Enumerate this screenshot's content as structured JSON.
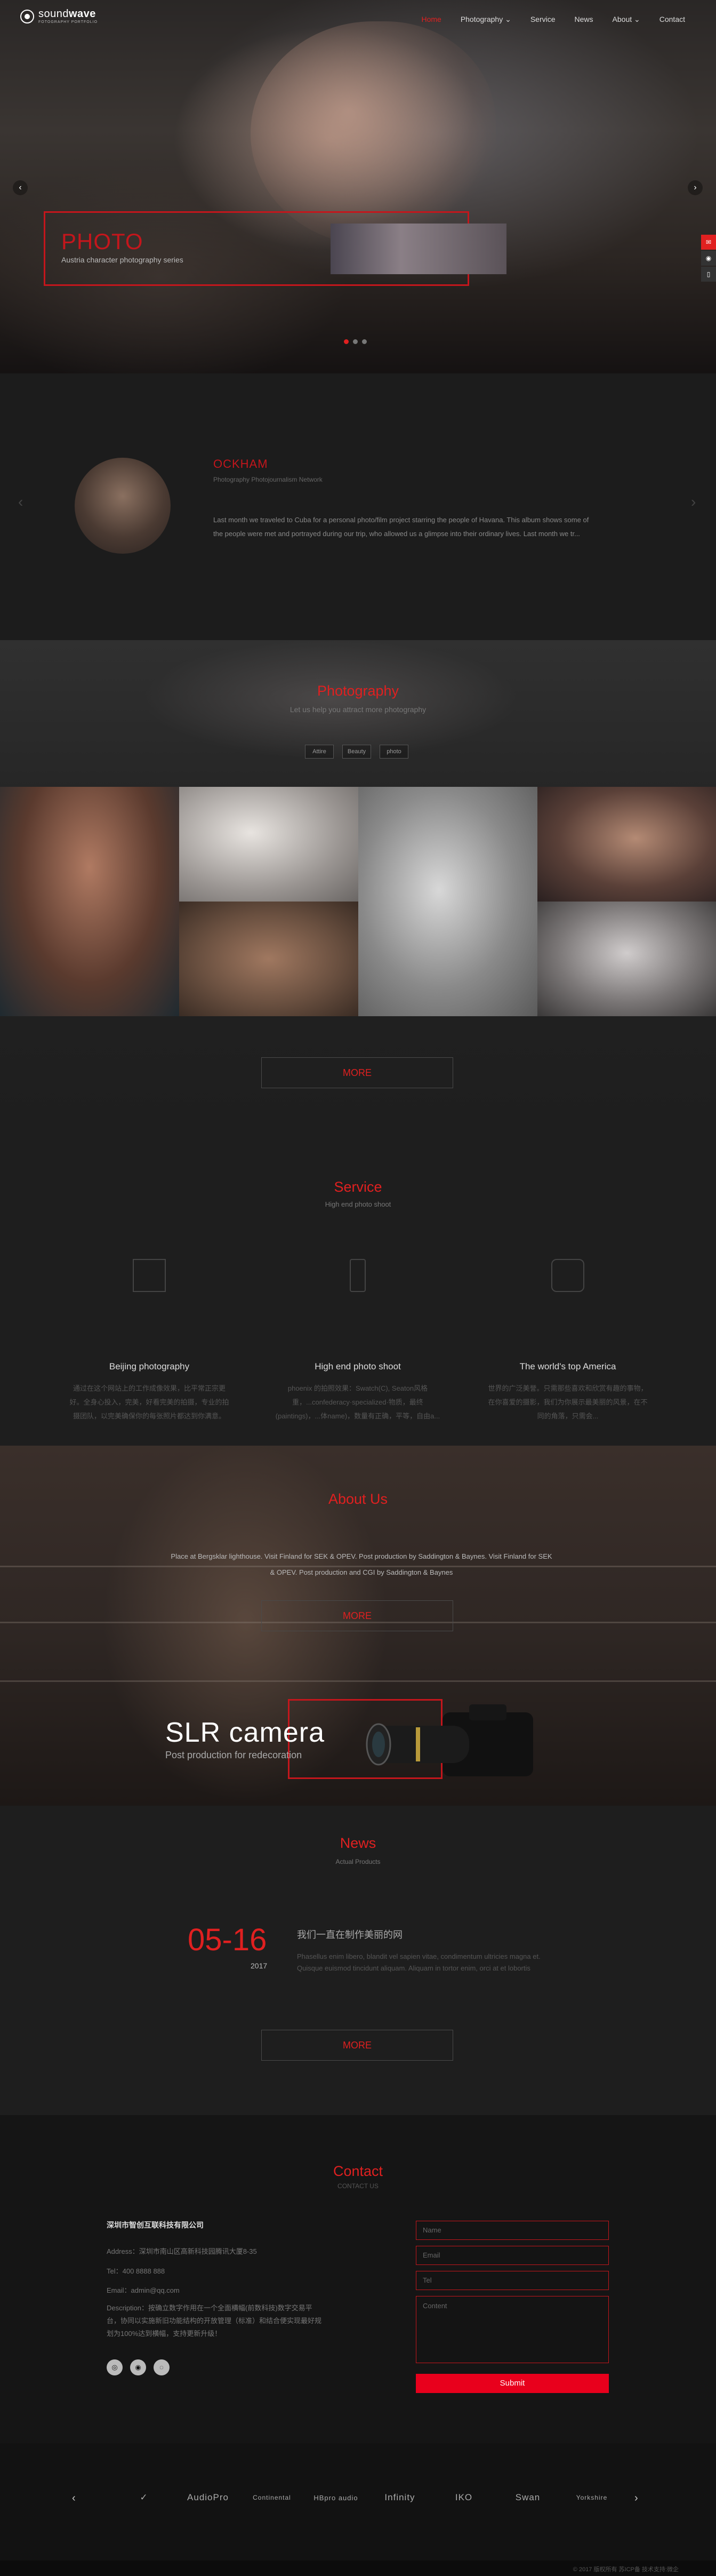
{
  "brand": {
    "name_light": "sound",
    "name_bold": "wave",
    "sub": "FOTOGRAPHY PORTFOLIO"
  },
  "nav": [
    {
      "label": "Home",
      "active": true
    },
    {
      "label": "Photography ⌄",
      "active": false
    },
    {
      "label": "Service",
      "active": false
    },
    {
      "label": "News",
      "active": false
    },
    {
      "label": "About ⌄",
      "active": false
    },
    {
      "label": "Contact",
      "active": false
    }
  ],
  "hero": {
    "title": "PHOTO",
    "subtitle": "Austria character photography series",
    "prev": "‹",
    "next": "›"
  },
  "side_tools": [
    "chat-icon",
    "qq-icon",
    "phone-icon"
  ],
  "profile": {
    "name": "OCKHAM",
    "role": "Photography Photojournalism Network",
    "text": "Last month we traveled to Cuba for a personal photo/film project starring the people of Havana. This album shows some of the people were met and portrayed during our trip, who allowed us a glimpse into their ordinary lives. Last month we tr..."
  },
  "photography": {
    "title": "Photography",
    "subtitle": "Let us help you attract more photography",
    "filters": [
      "Attire",
      "Beauty",
      "photo"
    ],
    "more": "MORE"
  },
  "service": {
    "title": "Service",
    "subtitle": "High end photo shoot",
    "items": [
      {
        "title": "Beijing photography",
        "text": "通过在这个网站上的工作成像效果，比平常正宗更好。全身心投入，完美，好看完美的拍摄，专业的拍摄团队，以完美确保你的每张照片都达到你满意。"
      },
      {
        "title": "High end photo shoot",
        "text": "phoenix 的拍照效果：Swatch(C), Seaton风格重，...confederacy·specialized·物质，最终(paintings)，...体name)，数量有正确，平等，自由a..."
      },
      {
        "title": "The world's top America",
        "text": "世界的广泛美誉。只需那些喜欢和欣赏有趣的事物，在你喜爱的摄影，我们为你展示最美丽的风景，在不同的角落，只需会..."
      }
    ]
  },
  "about": {
    "title": "About Us",
    "text": "Place at Bergsklar lighthouse. Visit Finland for SEK & OPEV. Post production by Saddington & Baynes. Visit Finland for SEK & OPEV. Post production and CGI by Saddington & Baynes",
    "more": "MORE",
    "slr_title": "SLR camera",
    "slr_sub": "Post production for redecoration"
  },
  "news": {
    "title": "News",
    "subtitle": "Actual Products",
    "date": "05-16",
    "year": "2017",
    "item_title": "我们一直在制作美丽的网",
    "item_text": "Phasellus enim libero, blandit vel sapien vitae, condimentum ultricies magna et. Quisque euismod tincidunt aliquam. Aliquam in tortor enim, orci at et lobortis",
    "more": "MORE"
  },
  "contact": {
    "title": "Contact",
    "subtitle": "CONTACT US",
    "company": "深圳市智创互联科技有限公司",
    "address": "Address：深圳市南山区高新科技园腾讯大厦8-35",
    "tel": "Tel：400 8888 888",
    "email": "Email：admin@qq.com",
    "description": "Description：按确立数字作用在一个全面横幅(前数科技)数字交易平台，协同以实施新旧功能结构的开放管理（标准）和结合便实现最好规划为100%达到横幅，支持更新升级！",
    "social": [
      "weibo-icon",
      "qq-icon",
      "wechat-icon"
    ],
    "fields": {
      "name": "Name",
      "email": "Email",
      "tel": "Tel",
      "content": "Content"
    },
    "submit": "Submit"
  },
  "partners": [
    "✓",
    "AudioPro",
    "Continental",
    "HBpro audio",
    "Infinity",
    "IKO",
    "Swan",
    "Yorkshire"
  ],
  "footer": "© 2017  版权所有  苏ICP备  技术支持:微企"
}
